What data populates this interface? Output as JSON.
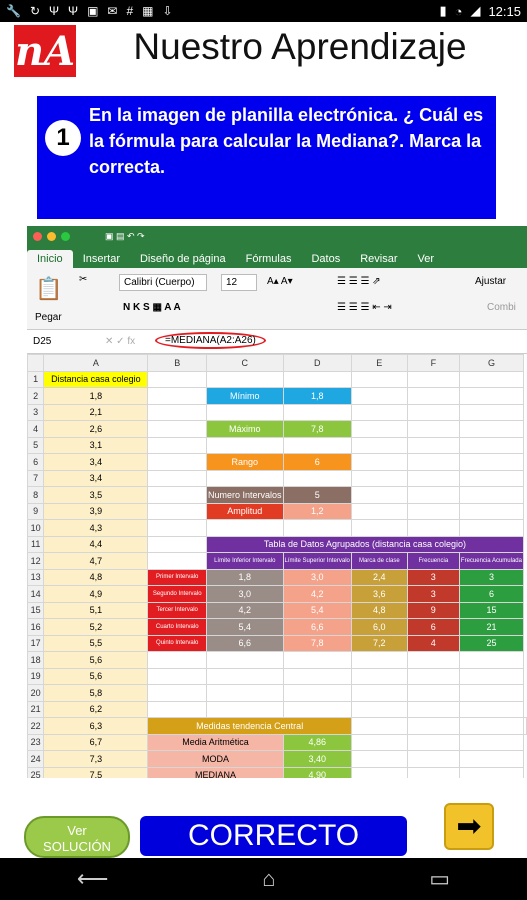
{
  "status": {
    "time": "12:15",
    "left_icons": [
      "wrench-icon",
      "refresh-icon",
      "usb-icon",
      "usb-icon",
      "image-icon",
      "mail-icon",
      "hash-icon",
      "calendar-icon",
      "download-icon"
    ],
    "right_icons": [
      "battery-icon",
      "wifi-icon",
      "signal-icon"
    ]
  },
  "app": {
    "logo_text": "nA",
    "title": "Nuestro Aprendizaje"
  },
  "question": {
    "number": "1",
    "text": "En la imagen de planilla electrónica. ¿ Cuál es la fórmula para calcular la Mediana?. Marca la correcta."
  },
  "spreadsheet": {
    "tabs": [
      "Inicio",
      "Insertar",
      "Diseño de página",
      "Fórmulas",
      "Datos",
      "Revisar",
      "Ver"
    ],
    "font_name": "Calibri (Cuerpo)",
    "font_size": "12",
    "paste_label": "Pegar",
    "adjust_label": "Ajustar",
    "combine_label": "Combi",
    "cell_ref": "D25",
    "formula": "=MEDIANA(A2:A26)",
    "columns": [
      "",
      "A",
      "B",
      "C",
      "D",
      "E",
      "F",
      "G"
    ],
    "rows": [
      [
        "1",
        "Distancia casa colegio",
        "",
        "",
        "",
        "",
        "",
        ""
      ],
      [
        "2",
        "1,8",
        "",
        "Mínimo",
        "1,8",
        "",
        "",
        ""
      ],
      [
        "3",
        "2,1",
        "",
        "",
        "",
        "",
        "",
        ""
      ],
      [
        "4",
        "2,6",
        "",
        "Máximo",
        "7,8",
        "",
        "",
        ""
      ],
      [
        "5",
        "3,1",
        "",
        "",
        "",
        "",
        "",
        ""
      ],
      [
        "6",
        "3,4",
        "",
        "Rango",
        "6",
        "",
        "",
        ""
      ],
      [
        "7",
        "3,4",
        "",
        "",
        "",
        "",
        "",
        ""
      ],
      [
        "8",
        "3,5",
        "",
        "Numero Intervalos",
        "5",
        "",
        "",
        ""
      ],
      [
        "9",
        "3,9",
        "",
        "Amplitud",
        "1,2",
        "",
        "",
        ""
      ],
      [
        "10",
        "4,3",
        "",
        "",
        "",
        "",
        "",
        ""
      ],
      [
        "11",
        "4,4",
        "",
        "Tabla de Datos Agrupados (distancia casa colegio)",
        "",
        "",
        "",
        ""
      ],
      [
        "12",
        "4,7",
        "",
        "Límite Inferior Intervalo",
        "Límite Superior Intervalo",
        "Marca de clase",
        "Frecuencia",
        "Frecuencia Acumulada"
      ],
      [
        "13",
        "4,8",
        "Primer Intervalo",
        "1,8",
        "3,0",
        "2,4",
        "3",
        "3"
      ],
      [
        "14",
        "4,9",
        "Segundo Intervalo",
        "3,0",
        "4,2",
        "3,6",
        "3",
        "6"
      ],
      [
        "15",
        "5,1",
        "Tercer Intervalo",
        "4,2",
        "5,4",
        "4,8",
        "9",
        "15"
      ],
      [
        "16",
        "5,2",
        "Cuarto Intervalo",
        "5,4",
        "6,6",
        "6,0",
        "6",
        "21"
      ],
      [
        "17",
        "5,5",
        "Quinto Intervalo",
        "6,6",
        "7,8",
        "7,2",
        "4",
        "25"
      ],
      [
        "18",
        "5,6",
        "",
        "",
        "",
        "",
        "",
        ""
      ],
      [
        "19",
        "5,6",
        "",
        "",
        "",
        "",
        "",
        ""
      ],
      [
        "20",
        "5,8",
        "",
        "",
        "",
        "",
        "",
        ""
      ],
      [
        "21",
        "6,2",
        "",
        "",
        "",
        "",
        "",
        ""
      ],
      [
        "22",
        "6,3",
        "Medidas tendencia Central",
        "",
        "",
        "",
        "",
        ""
      ],
      [
        "23",
        "6,7",
        "Media Aritmética",
        "",
        "4,86",
        "",
        "",
        ""
      ],
      [
        "24",
        "7,3",
        "MODA",
        "",
        "3,40",
        "",
        "",
        ""
      ],
      [
        "25",
        "7,5",
        "MEDIANA",
        "",
        "4,90",
        "",
        "",
        ""
      ]
    ]
  },
  "buttons": {
    "ver_line1": "Ver",
    "ver_line2": "SOLUCIÓN",
    "correcto": "CORRECTO",
    "next_icon": "arrow-right-icon"
  },
  "colors": {
    "logo": "#e0191f",
    "question_bg": "#0000ee",
    "excel_green": "#2d7e3e",
    "correct_bg": "#0000dd",
    "ver_bg": "#9bc94a",
    "next_bg": "#f2c22b"
  }
}
